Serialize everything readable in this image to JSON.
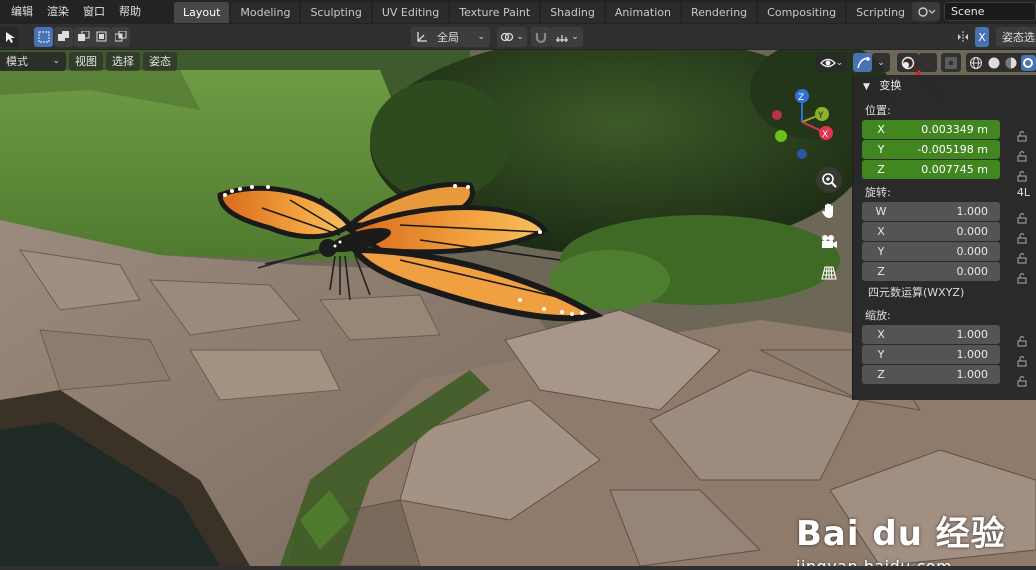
{
  "menu": [
    "编辑",
    "渲染",
    "窗口",
    "帮助"
  ],
  "workspace_tabs": [
    "Layout",
    "Modeling",
    "Sculpting",
    "UV Editing",
    "Texture Paint",
    "Shading",
    "Animation",
    "Rendering",
    "Compositing",
    "Scripting"
  ],
  "workspace_add": "+",
  "scene": {
    "name": "Scene"
  },
  "toolbar": {
    "transform_orientation": "全局",
    "right_label": "姿态选",
    "x_toggle": "X"
  },
  "viewport_header": {
    "mode": "模式",
    "menus": [
      "视图",
      "选择",
      "姿态"
    ]
  },
  "gizmo": {
    "x": "X",
    "y": "Y",
    "z": "Z"
  },
  "npanel": {
    "section": "变换",
    "location_label": "位置:",
    "location": [
      {
        "axis": "X",
        "value": "0.003349 m"
      },
      {
        "axis": "Y",
        "value": "-0.005198 m"
      },
      {
        "axis": "Z",
        "value": "0.007745 m"
      }
    ],
    "rotation_label": "旋转:",
    "rotation_mode_short": "4L",
    "rotation": [
      {
        "axis": "W",
        "value": "1.000"
      },
      {
        "axis": "X",
        "value": "0.000"
      },
      {
        "axis": "Y",
        "value": "0.000"
      },
      {
        "axis": "Z",
        "value": "0.000"
      }
    ],
    "rotation_mode": "四元数运算(WXYZ)",
    "scale_label": "缩放:",
    "scale": [
      {
        "axis": "X",
        "value": "1.000"
      },
      {
        "axis": "Y",
        "value": "1.000"
      },
      {
        "axis": "Z",
        "value": "1.000"
      }
    ]
  },
  "watermark": {
    "logo": "Bai du 经验",
    "url": "jingyan.baidu.com"
  },
  "colors": {
    "accent": "#4772b3",
    "location_field": "#42861f",
    "annotation_arrow": "#e21b1b"
  }
}
